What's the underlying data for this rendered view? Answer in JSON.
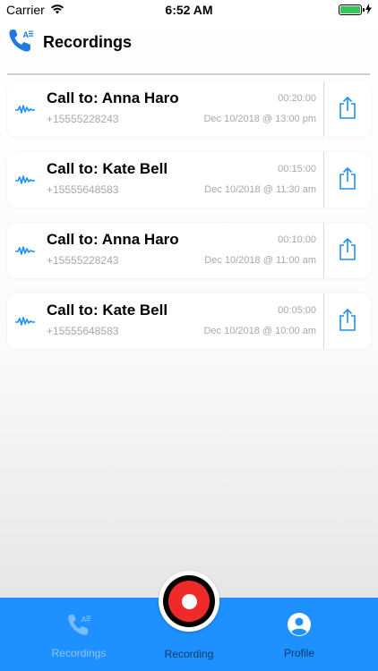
{
  "status_bar": {
    "carrier": "Carrier",
    "time": "6:52 AM"
  },
  "header": {
    "title": "Recordings",
    "icon": "phone-transcript-icon"
  },
  "colors": {
    "accent": "#1e90ff",
    "record_red": "#ee2a2a",
    "muted_text": "#a9a9a9"
  },
  "recordings": [
    {
      "contact": "Call to: Anna Haro",
      "phone": "+15555228243",
      "duration": "00:20:00",
      "timestamp": "Dec 10/2018 @ 13:00 pm"
    },
    {
      "contact": "Call to: Kate Bell",
      "phone": "+15555648583",
      "duration": "00:15:00",
      "timestamp": "Dec 10/2018 @ 11:30 am"
    },
    {
      "contact": "Call to: Anna Haro",
      "phone": "+15555228243",
      "duration": "00:10:00",
      "timestamp": "Dec 10/2018 @ 11:00 am"
    },
    {
      "contact": "Call to: Kate Bell",
      "phone": "+15555648583",
      "duration": "00:05:00",
      "timestamp": "Dec 10/2018 @ 10:00 am"
    }
  ],
  "tabs": [
    {
      "label": "Recordings",
      "icon": "phone-transcript-icon"
    },
    {
      "label": "Recording",
      "icon": "record-icon"
    },
    {
      "label": "Profile",
      "icon": "profile-icon"
    }
  ]
}
